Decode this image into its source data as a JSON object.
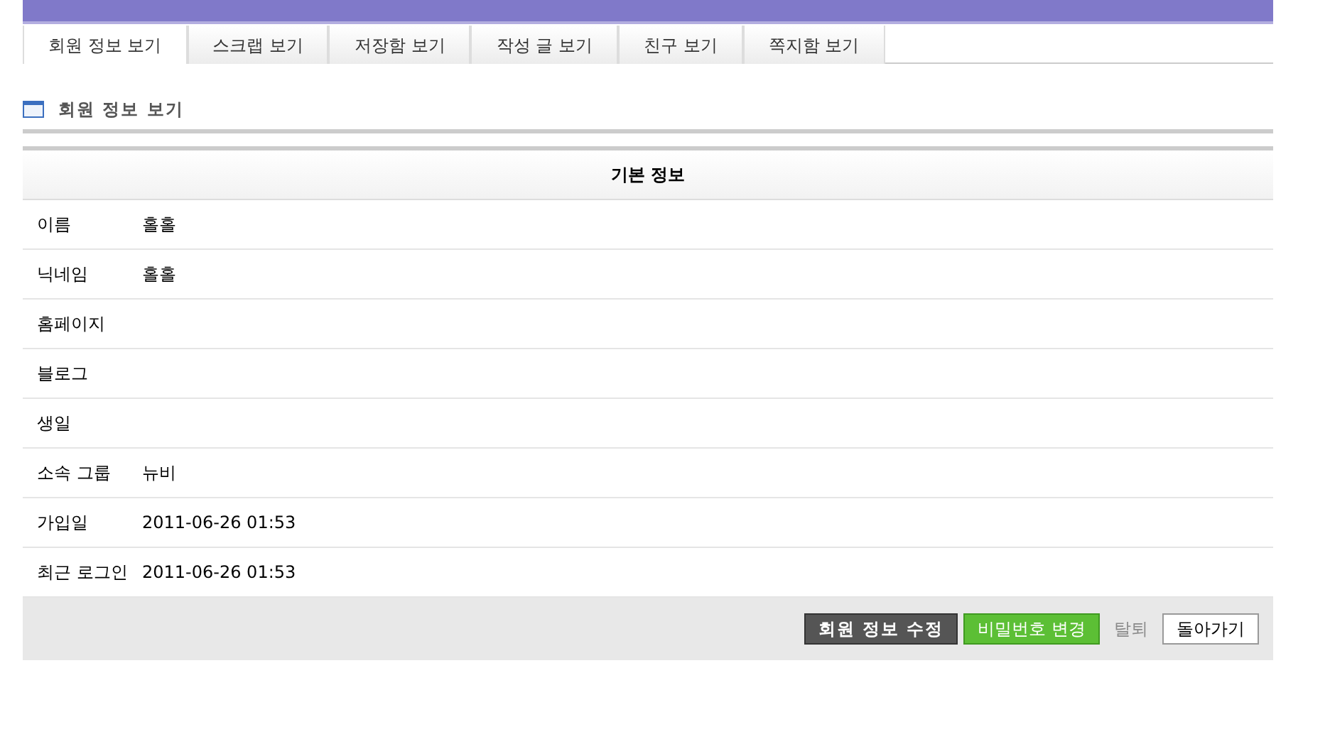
{
  "tabs": [
    {
      "label": "회원 정보 보기",
      "selected": true
    },
    {
      "label": "스크랩 보기",
      "selected": false
    },
    {
      "label": "저장함 보기",
      "selected": false
    },
    {
      "label": "작성 글 보기",
      "selected": false
    },
    {
      "label": "친구 보기",
      "selected": false
    },
    {
      "label": "쪽지함 보기",
      "selected": false
    }
  ],
  "section_title": "회원 정보 보기",
  "table": {
    "heading": "기본 정보",
    "rows": [
      {
        "label": "이름",
        "value": "홀홀"
      },
      {
        "label": "닉네임",
        "value": "홀홀"
      },
      {
        "label": "홈페이지",
        "value": ""
      },
      {
        "label": "블로그",
        "value": ""
      },
      {
        "label": "생일",
        "value": ""
      },
      {
        "label": "소속 그룹",
        "value": "뉴비"
      },
      {
        "label": "가입일",
        "value": "2011-06-26 01:53"
      },
      {
        "label": "최근 로그인",
        "value": "2011-06-26 01:53"
      }
    ]
  },
  "buttons": [
    {
      "label": "회원 정보 수정",
      "kind": "dark"
    },
    {
      "label": "비밀번호 변경",
      "kind": "green"
    },
    {
      "label": "탈퇴",
      "kind": "link"
    },
    {
      "label": "돌아가기",
      "kind": "plain"
    }
  ]
}
